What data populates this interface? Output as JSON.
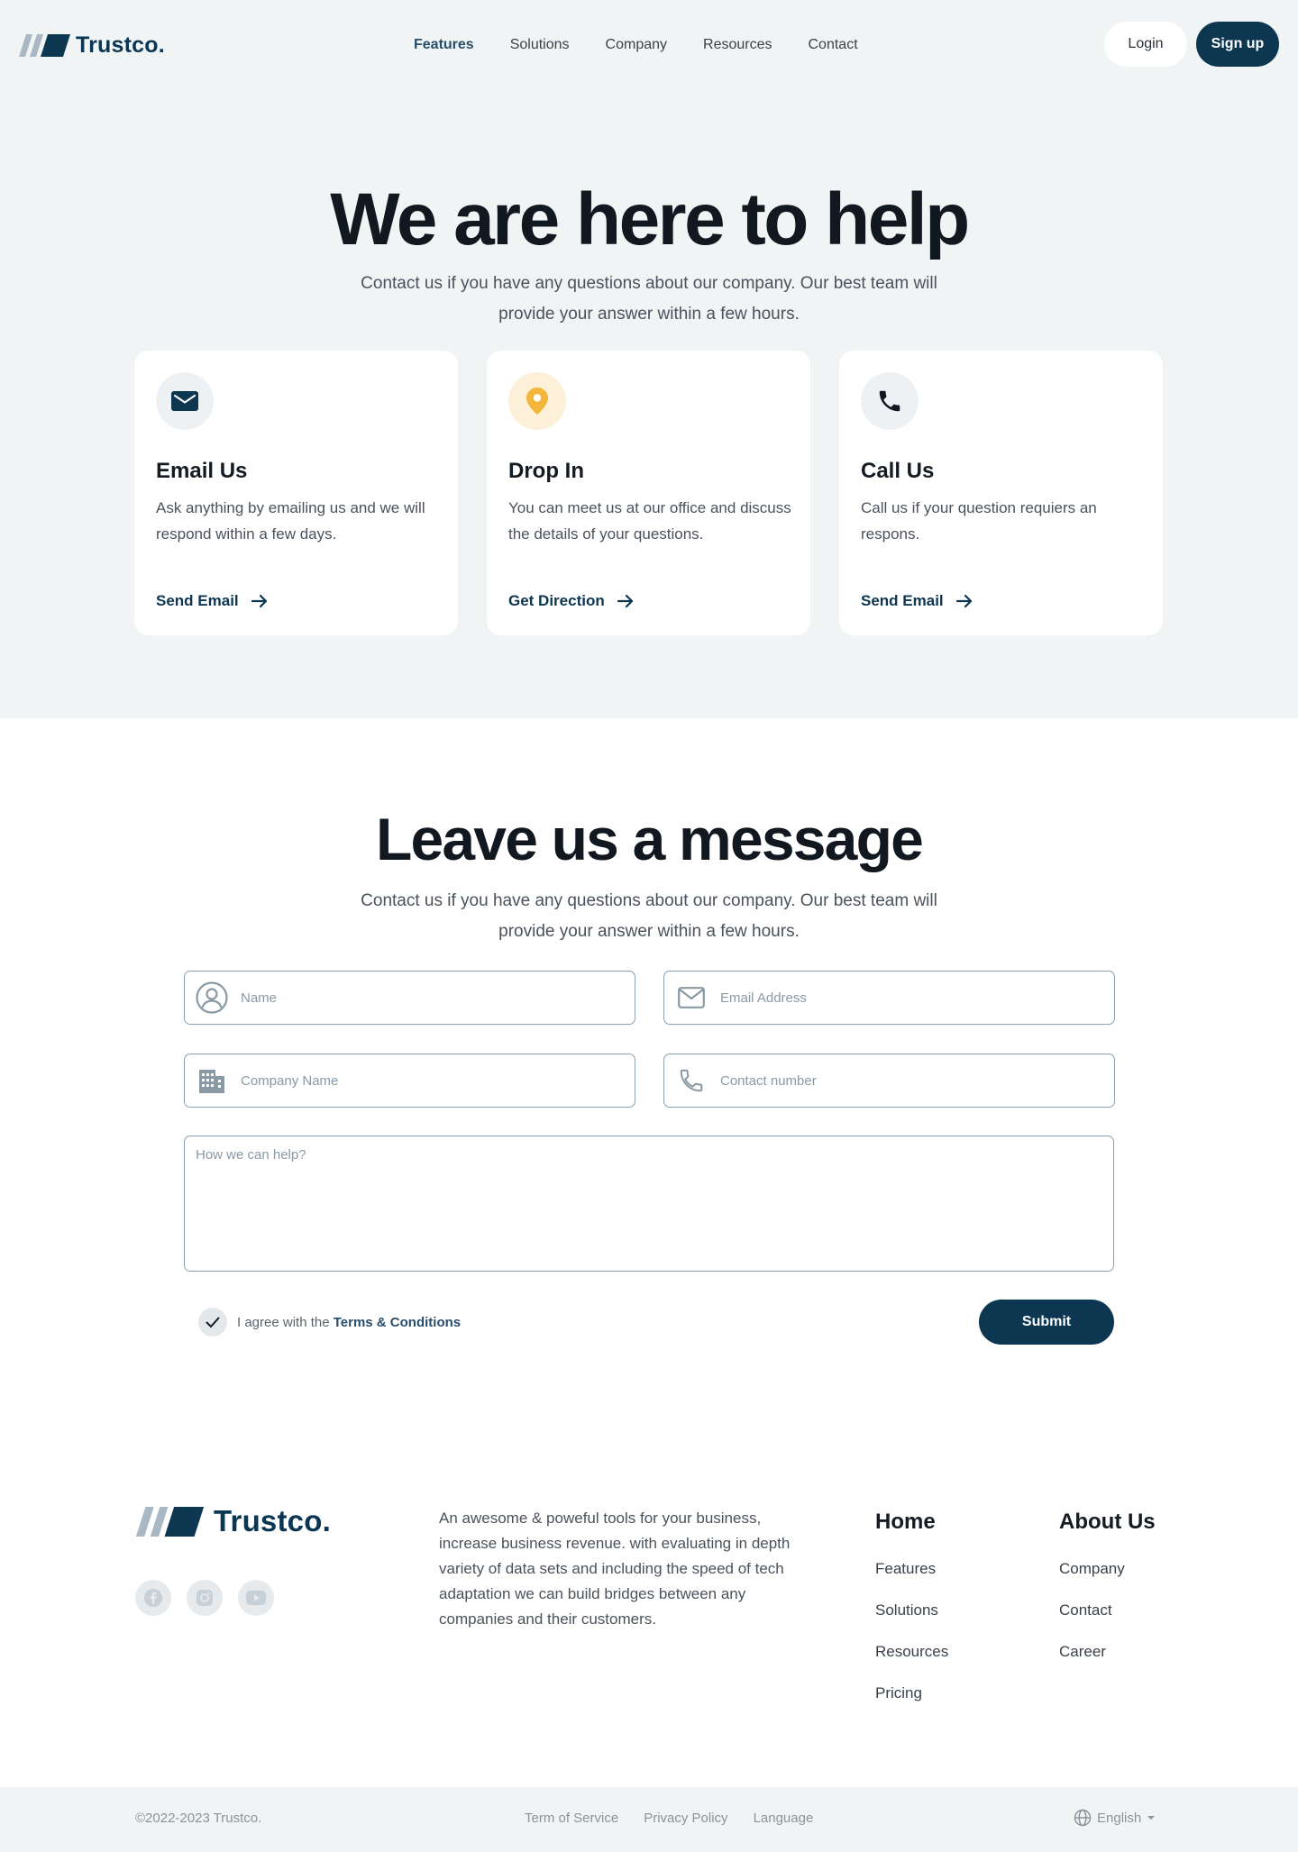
{
  "brand": {
    "name": "Trustco.",
    "primary_color": "#0d3651",
    "accent_yellow": "#f2b63a"
  },
  "nav": {
    "links": [
      {
        "label": "Features",
        "active": true
      },
      {
        "label": "Solutions"
      },
      {
        "label": "Company"
      },
      {
        "label": "Resources"
      },
      {
        "label": "Contact"
      }
    ],
    "login_label": "Login",
    "signup_label": "Sign up"
  },
  "hero": {
    "title": "We are here to help",
    "subtitle": "Contact us if you have any questions about our company. Our best team will provide your answer within a few hours."
  },
  "cards": [
    {
      "icon": "envelope-icon",
      "title": "Email Us",
      "description": "Ask anything by emailing us and we will respond within a few days.",
      "link_label": "Send Email"
    },
    {
      "icon": "location-pin-icon",
      "title": "Drop In",
      "description": "You can meet us at our office and discuss the details of your questions.",
      "link_label": "Get Direction"
    },
    {
      "icon": "phone-icon",
      "title": "Call Us",
      "description": "Call us if your question requiers an respons.",
      "link_label": "Send Email"
    }
  ],
  "message": {
    "title": "Leave us a message",
    "subtitle": "Contact us if you have any questions about our company. Our best team will provide your answer within a few hours.",
    "fields": {
      "name_placeholder": "Name",
      "email_placeholder": "Email Address",
      "company_placeholder": "Company Name",
      "phone_placeholder": "Contact number",
      "help_placeholder": "How we can help?"
    },
    "agree_prefix": "I agree with the",
    "terms_label": "Terms & Conditions",
    "agree_checked": true,
    "submit_label": "Submit"
  },
  "footer": {
    "brand_name": "Trustco.",
    "description": "An awesome & poweful tools for your business, increase business revenue. with evaluating in depth variety of data sets and including the speed of tech adaptation we can build bridges between any companies and their customers.",
    "socials": [
      "facebook-icon",
      "instagram-icon",
      "youtube-icon"
    ],
    "columns": [
      {
        "title": "Home",
        "items": [
          "Features",
          "Solutions",
          "Resources",
          "Pricing"
        ]
      },
      {
        "title": "About Us",
        "items": [
          "Company",
          "Contact",
          "Career"
        ]
      }
    ]
  },
  "bottom_bar": {
    "copyright": "©2022-2023 Trustco.",
    "legal_links": [
      "Term of Service",
      "Privacy Policy",
      "Language"
    ],
    "language_label": "English"
  }
}
